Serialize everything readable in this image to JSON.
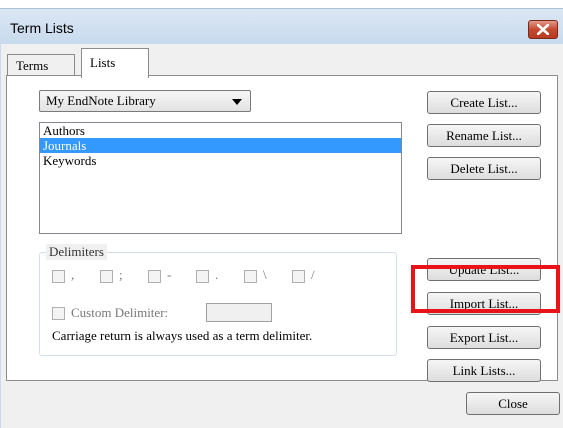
{
  "window": {
    "title": "Term Lists",
    "close_label": "✕"
  },
  "tabs": [
    {
      "label": "Terms",
      "active": false
    },
    {
      "label": "Lists",
      "active": true
    }
  ],
  "library_select": {
    "value": "My EndNote Library"
  },
  "lists": [
    "Authors",
    "Journals",
    "Keywords"
  ],
  "selected_list": "Journals",
  "buttons": {
    "create": "Create List...",
    "rename": "Rename List...",
    "delete": "Delete List...",
    "update": "Update List...",
    "import": "Import List...",
    "export": "Export List...",
    "link": "Link Lists...",
    "close": "Close"
  },
  "delimiters": {
    "title": "Delimiters",
    "options": [
      ",",
      ";",
      "-",
      ".",
      "\\",
      "/"
    ],
    "custom_label": "Custom Delimiter:",
    "custom_value": "",
    "note": "Carriage return is always used as a term delimiter."
  },
  "colors": {
    "selection": "#3399ff",
    "highlight_box": "#e8141a"
  }
}
